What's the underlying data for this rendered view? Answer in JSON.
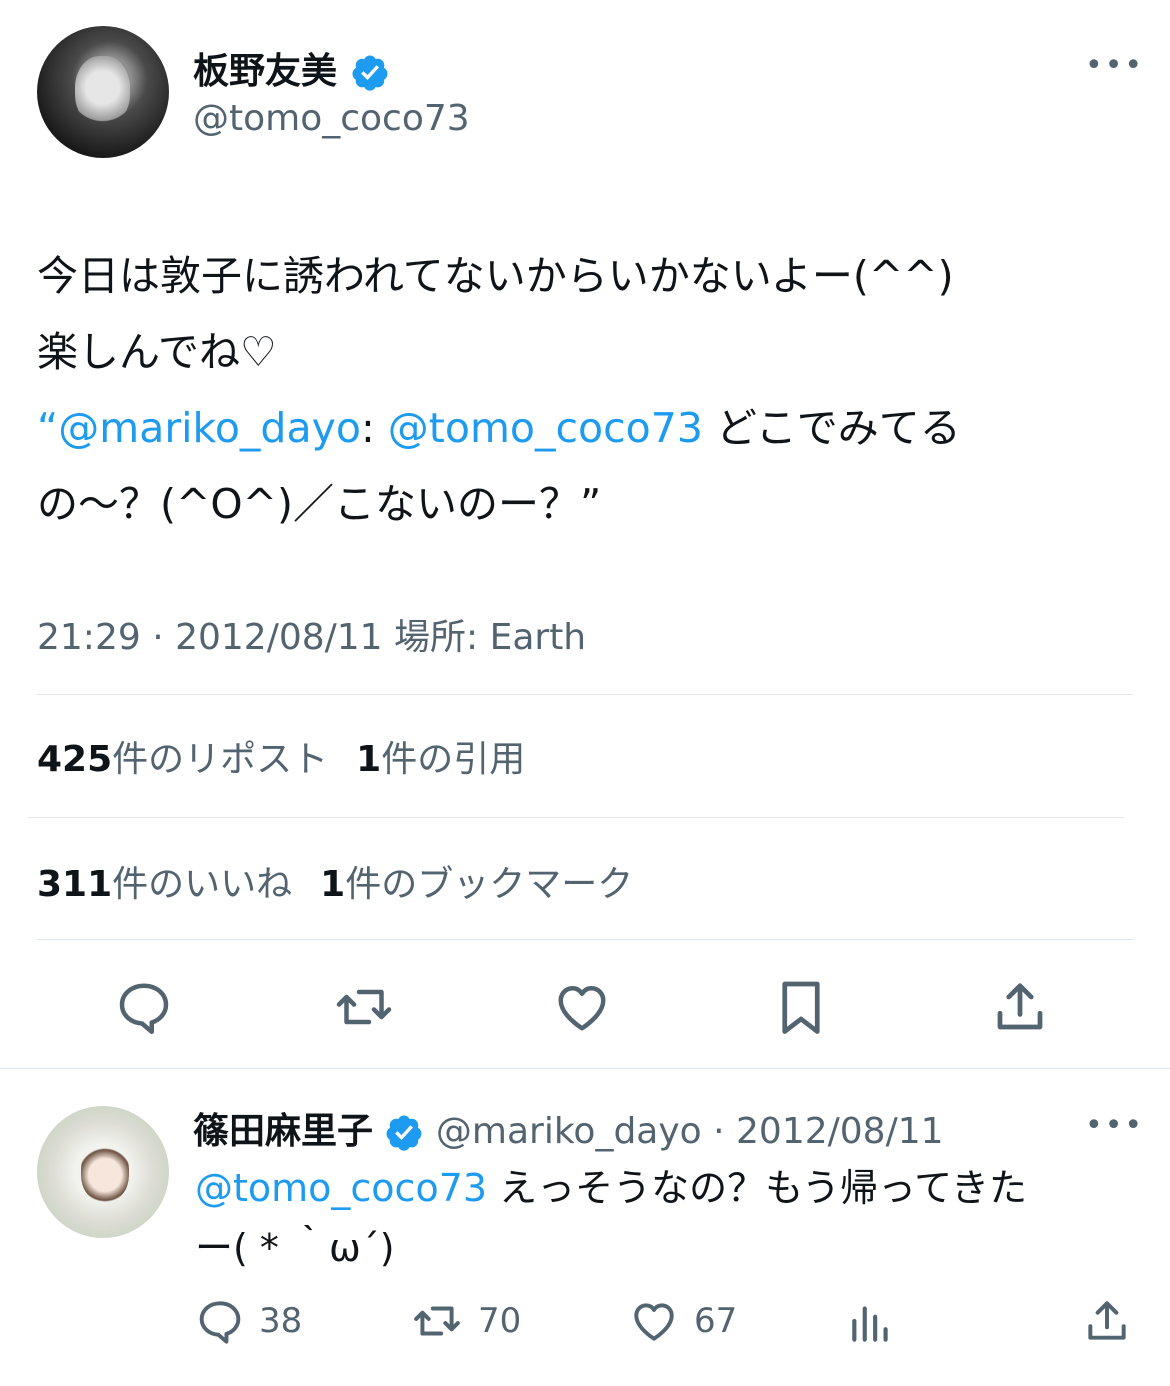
{
  "tweet": {
    "author_name": "板野友美",
    "author_handle": "@tomo_coco73",
    "more_label": "•••",
    "text_line1": "今日は敦子に誘われてないからいかないよー(^^)",
    "text_line2": "楽しんでね♡",
    "quote_open": "“",
    "quote_mention1": "@mariko_dayo",
    "quote_colon": ": ",
    "quote_mention2": "@tomo_coco73",
    "quote_tail": " どこでみてる",
    "text_line4": "の〜？(^O^)／こないのー？”",
    "meta": "21:29 · 2012/08/11 場所: Earth",
    "reposts_count": "425",
    "reposts_label": "件のリポスト",
    "quotes_count": "1",
    "quotes_label": "件の引用",
    "likes_count": "311",
    "likes_label": "件のいいね",
    "bookmarks_count": "1",
    "bookmarks_label": "件のブックマーク"
  },
  "reply": {
    "author_name": "篠田麻里子",
    "author_handle": "@mariko_dayo",
    "date": "· 2012/08/11",
    "more_label": "•••",
    "mention": "@tomo_coco73",
    "text_line1": " えっそうなの？もう帰ってきた",
    "text_line2": "ー( * ｀ω´)",
    "replies": "38",
    "reposts": "70",
    "likes": "67"
  },
  "colors": {
    "link": "#1d9bf0",
    "secondary": "#536471",
    "text": "#0f1419",
    "verified": "#1d9bf0",
    "divider": "#e1e8ed"
  },
  "icons": [
    "verified-badge-icon",
    "more-icon",
    "reply-icon",
    "retweet-icon",
    "heart-icon",
    "bookmark-icon",
    "share-icon",
    "views-icon"
  ]
}
